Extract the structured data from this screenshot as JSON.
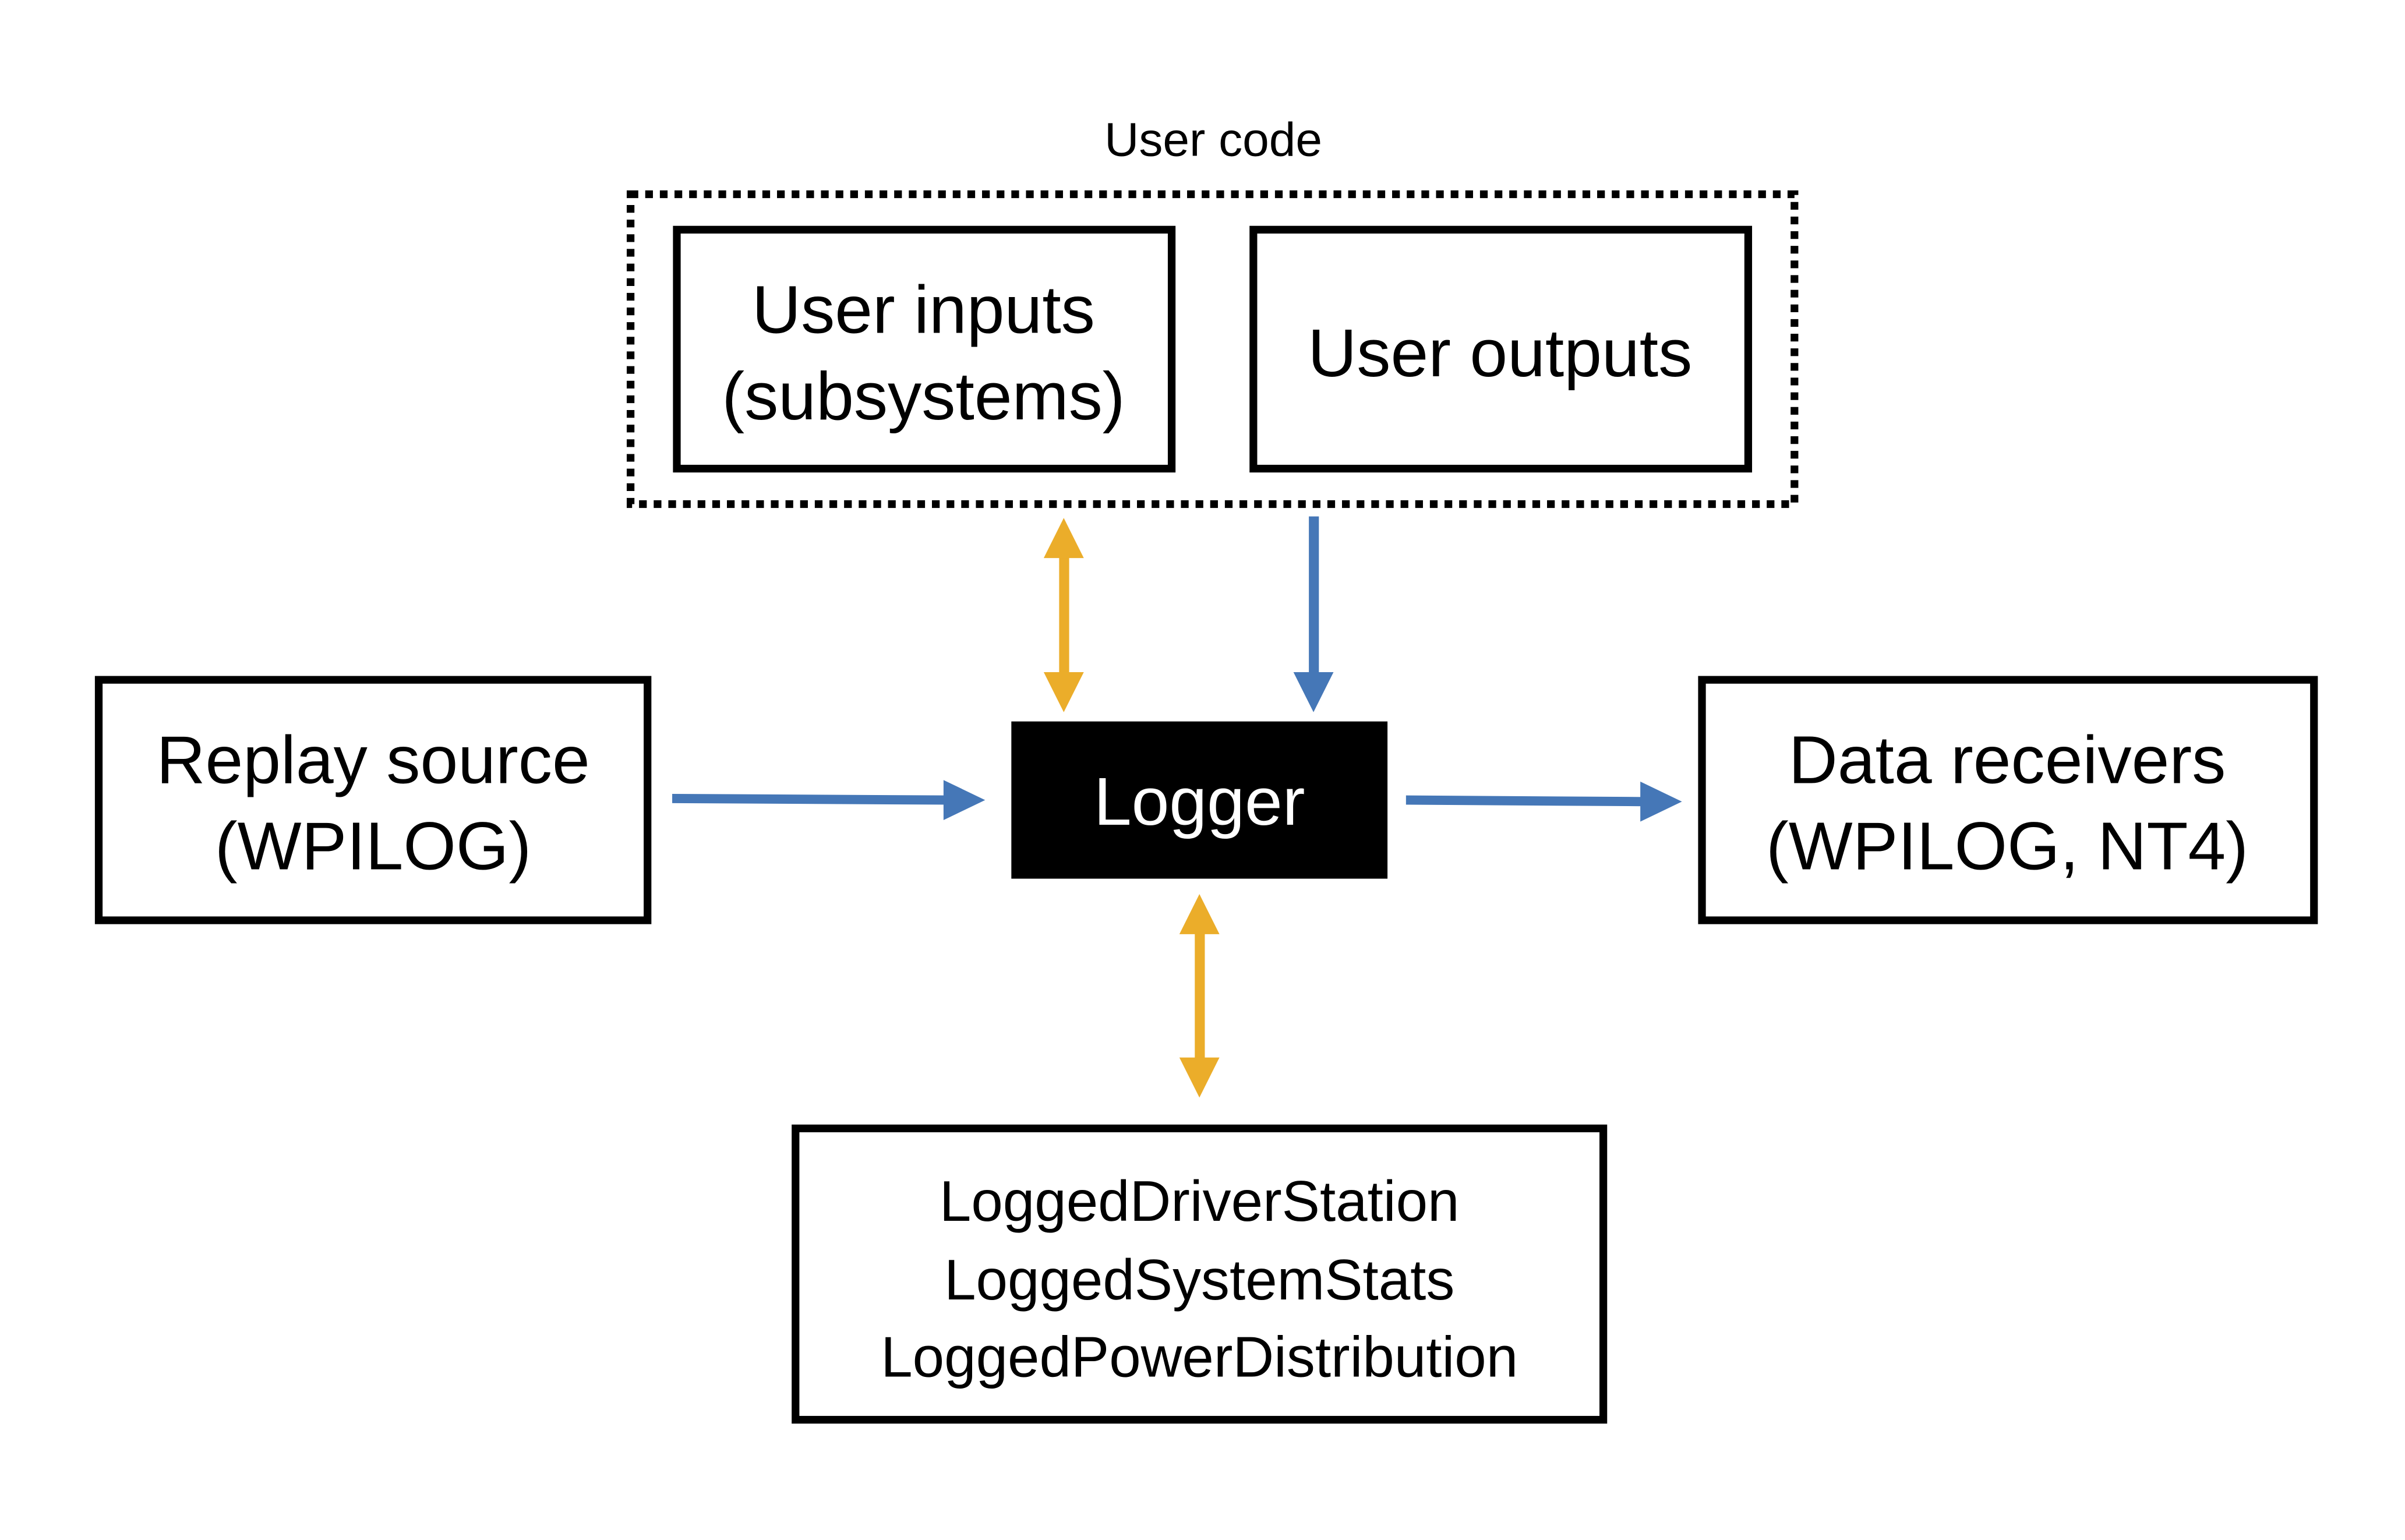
{
  "colors": {
    "bidirectional_arrow": "#EBAD2A",
    "data_flow_arrow": "#4577B7",
    "logger_fill": "#000000",
    "logger_text": "#FFFFFF"
  },
  "user_code": {
    "label": "User code"
  },
  "user_inputs": {
    "line1": "User inputs",
    "line2": "(subsystems)"
  },
  "user_outputs": {
    "label": "User outputs"
  },
  "replay_source": {
    "line1": "Replay source",
    "line2": "(WPILOG)"
  },
  "logger": {
    "label": "Logger"
  },
  "data_receivers": {
    "line1": "Data receivers",
    "line2": "(WPILOG, NT4)"
  },
  "built_ins": {
    "items": [
      "LoggedDriverStation",
      "LoggedSystemStats",
      "LoggedPowerDistribution"
    ]
  }
}
